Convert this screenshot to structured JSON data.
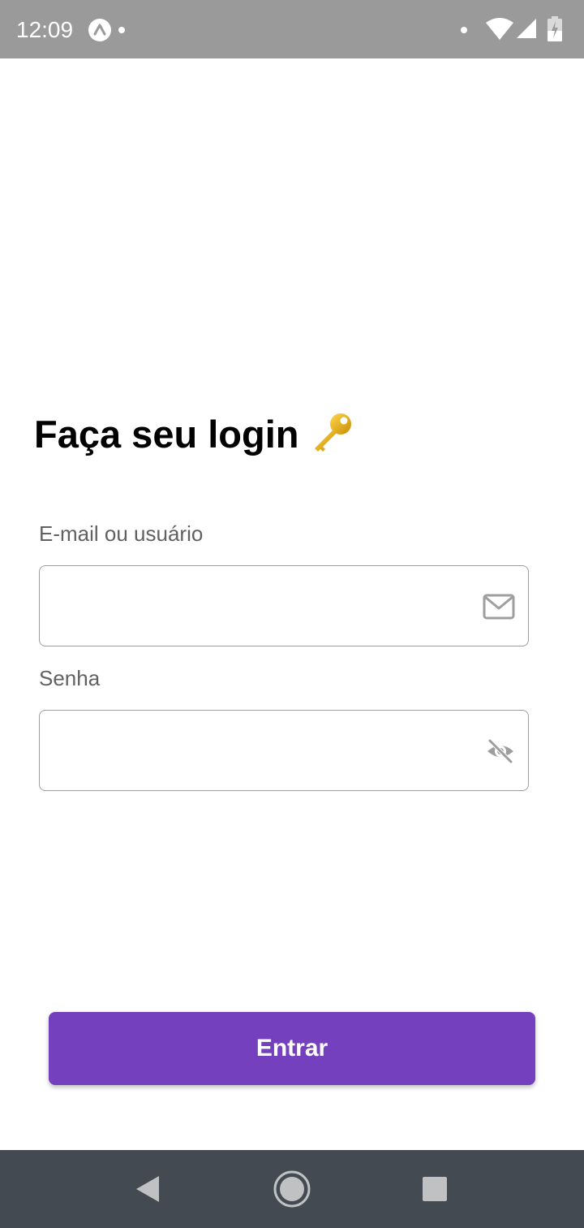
{
  "status_bar": {
    "time": "12:09",
    "icons": [
      "expo-icon",
      "notification-dot",
      "wifi-icon",
      "signal-icon",
      "battery-icon"
    ]
  },
  "login": {
    "title": "Faça seu login",
    "title_icon": "key-icon",
    "email_label": "E-mail ou usuário",
    "email_value": "",
    "email_placeholder": "",
    "email_icon": "mail-icon",
    "password_label": "Senha",
    "password_value": "",
    "password_placeholder": "",
    "password_icon": "eye-off-icon",
    "submit_label": "Entrar"
  },
  "navigation": {
    "icons": [
      "back-icon",
      "home-icon",
      "recents-icon"
    ]
  },
  "colors": {
    "status_bar": "#9a9a9a",
    "primary": "#7540be",
    "label": "#616161",
    "input_border": "#9e9e9e",
    "nav_bar": "#444a51"
  }
}
